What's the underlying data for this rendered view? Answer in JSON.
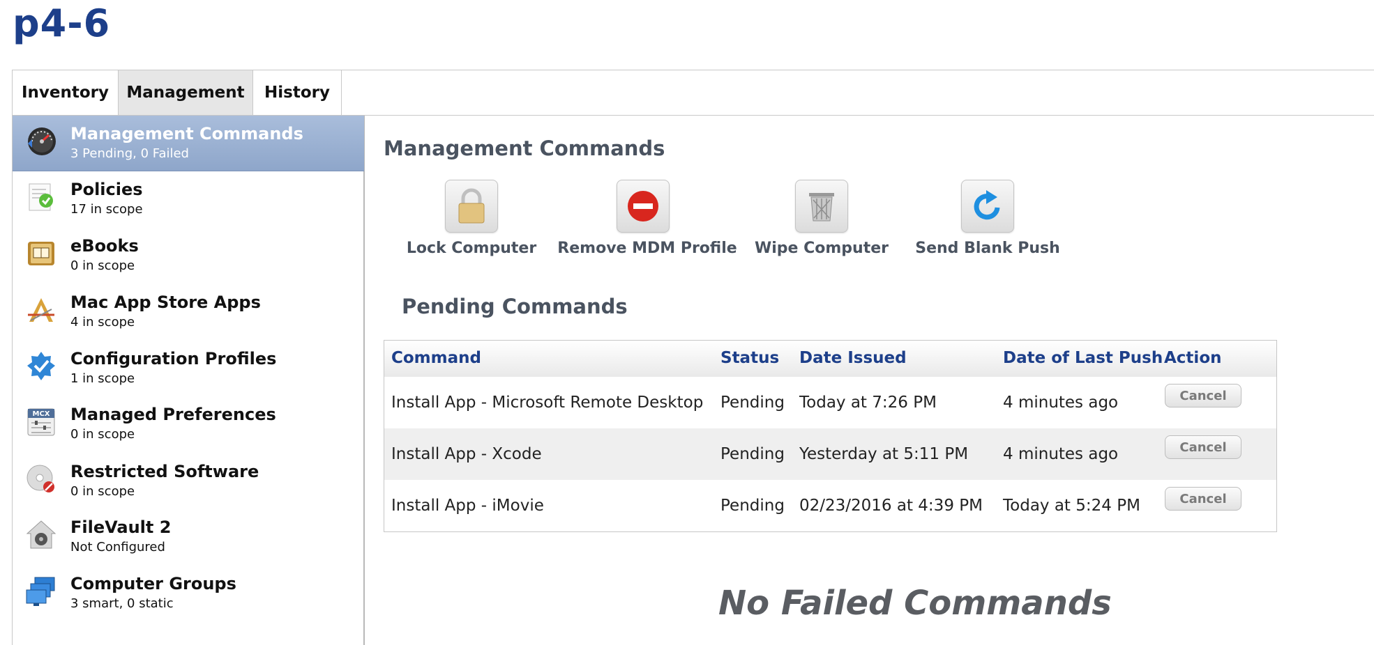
{
  "page": {
    "title": "p4-6"
  },
  "tabs": [
    {
      "label": "Inventory"
    },
    {
      "label": "Management"
    },
    {
      "label": "History"
    }
  ],
  "sidebar": {
    "items": [
      {
        "title": "Management Commands",
        "subtitle": "3 Pending, 0 Failed",
        "icon": "gauge-icon"
      },
      {
        "title": "Policies",
        "subtitle": "17 in scope",
        "icon": "policy-document-icon"
      },
      {
        "title": "eBooks",
        "subtitle": "0 in scope",
        "icon": "book-icon"
      },
      {
        "title": "Mac App Store Apps",
        "subtitle": "4 in scope",
        "icon": "app-store-icon"
      },
      {
        "title": "Configuration Profiles",
        "subtitle": "1 in scope",
        "icon": "checkmark-badge-icon"
      },
      {
        "title": "Managed Preferences",
        "subtitle": "0 in scope",
        "icon": "mcx-icon"
      },
      {
        "title": "Restricted Software",
        "subtitle": "0 in scope",
        "icon": "restricted-disc-icon"
      },
      {
        "title": "FileVault 2",
        "subtitle": "Not Configured",
        "icon": "vault-icon"
      },
      {
        "title": "Computer Groups",
        "subtitle": "3 smart, 0 static",
        "icon": "computers-icon"
      }
    ]
  },
  "main": {
    "title": "Management Commands",
    "commands": [
      {
        "label": "Lock Computer",
        "icon": "padlock-icon"
      },
      {
        "label": "Remove MDM Profile",
        "icon": "no-entry-icon"
      },
      {
        "label": "Wipe Computer",
        "icon": "trash-icon"
      },
      {
        "label": "Send Blank Push",
        "icon": "refresh-arrow-icon"
      }
    ],
    "pending": {
      "title": "Pending Commands",
      "columns": [
        "Command",
        "Status",
        "Date Issued",
        "Date of Last Push",
        "Action"
      ],
      "rows": [
        {
          "command": "Install App - Microsoft Remote Desktop",
          "status": "Pending",
          "issued": "Today at 7:26 PM",
          "last_push": "4 minutes ago",
          "action": "Cancel"
        },
        {
          "command": "Install App - Xcode",
          "status": "Pending",
          "issued": "Yesterday at 5:11 PM",
          "last_push": "4 minutes ago",
          "action": "Cancel"
        },
        {
          "command": "Install App - iMovie",
          "status": "Pending",
          "issued": "02/23/2016 at 4:39 PM",
          "last_push": "Today at 5:24 PM",
          "action": "Cancel"
        }
      ]
    },
    "failed_message": "No Failed Commands"
  },
  "colors": {
    "brand_blue": "#1d3f8a",
    "sidebar_active": "#9bb1d3",
    "section_gray": "#4a5360"
  }
}
